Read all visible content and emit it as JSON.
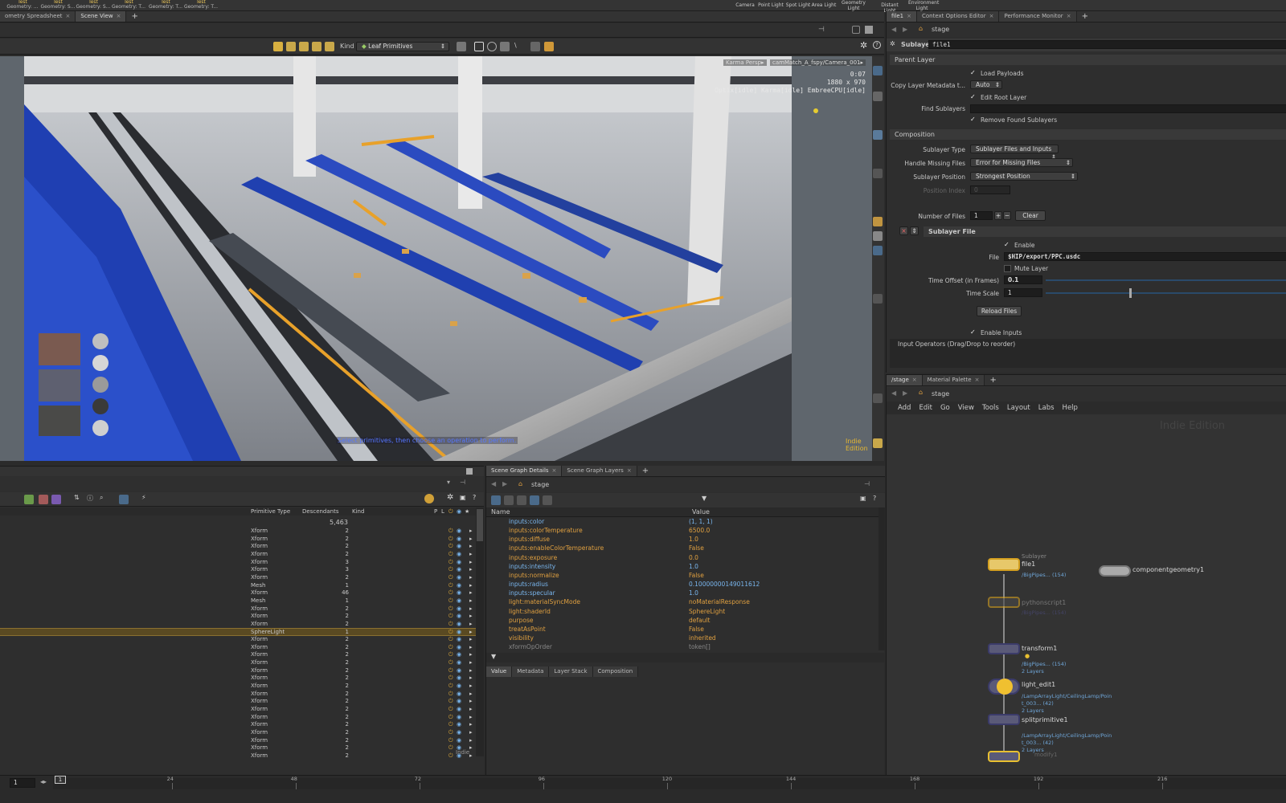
{
  "shelf": {
    "tools": [
      {
        "l1": "Test",
        "l2": "Geometry: ..."
      },
      {
        "l1": "Test",
        "l2": "Geometry: S..."
      },
      {
        "l1": "Test",
        "l2": "Geometry: S..."
      },
      {
        "l1": "Test",
        "l2": "Geometry: T..."
      },
      {
        "l1": "Test",
        "l2": "Geometry: T..."
      },
      {
        "l1": "Test",
        "l2": "Geometry: T..."
      }
    ],
    "lights": [
      "Camera",
      "Point Light",
      "Spot Light",
      "Area Light",
      "Geometry Light",
      "Distant Light",
      "Environment Light"
    ]
  },
  "left_tabs": [
    "ometry Spreadsheet",
    "Scene View"
  ],
  "viewport": {
    "kind_label": "Kind",
    "kind_value": "Leaf Primitives",
    "renderer": "Karma",
    "persp": "Persp",
    "camera": "camMatch_A_fspy/Camera_001",
    "time": "0:07",
    "resolution": "1880 x 970",
    "status": "Optix[idle] Karma[idle] EmbreeCPU[idle]",
    "prompt": "Select primitives, then choose an operation to perform.",
    "watermark": "Indie Edition"
  },
  "right_top_tabs": [
    "file1",
    "Context Options Editor",
    "Performance Monitor"
  ],
  "params": {
    "path": "stage",
    "node_type": "Sublayer",
    "node_name": "file1",
    "parent_layer": "Parent Layer",
    "load_payloads": "Load Payloads",
    "copy_meta_label": "Copy Layer Metadata t...",
    "copy_meta_value": "Auto",
    "edit_root": "Edit Root Layer",
    "find_sublayers": "Find Sublayers",
    "remove_found": "Remove Found Sublayers",
    "composition": "Composition",
    "sublayer_type_label": "Sublayer Type",
    "sublayer_type_value": "Sublayer Files and Inputs",
    "missing_label": "Handle Missing Files",
    "missing_value": "Error for Missing Files",
    "position_label": "Sublayer Position",
    "position_value": "Strongest Position",
    "position_index_label": "Position Index",
    "position_index_value": "0",
    "num_files_label": "Number of Files",
    "num_files_value": "1",
    "clear": "Clear",
    "sublayer_file": "Sublayer File",
    "enable": "Enable",
    "file_label": "File",
    "file_value": "$HIP/export/PPC.usdc",
    "mute": "Mute Layer",
    "time_offset_label": "Time Offset (in Frames)",
    "time_offset_value": "0.1",
    "time_scale_label": "Time Scale",
    "time_scale_value": "1",
    "reload": "Reload Files",
    "enable_inputs": "Enable Inputs",
    "input_ops": "Input Operators (Drag/Drop to reorder)"
  },
  "network": {
    "tabs": [
      "/stage",
      "Material Palette"
    ],
    "path": "stage",
    "menu": [
      "Add",
      "Edit",
      "Go",
      "View",
      "Tools",
      "Layout",
      "Labs",
      "Help"
    ],
    "watermark": "Indie Edition",
    "nodes": [
      {
        "type": "Sublayer",
        "name": "file1",
        "info": "/BigPipes... (154)"
      },
      {
        "name": "componentgeometry1"
      },
      {
        "name": "pythonscript1",
        "info": "/BigPipes... (154)"
      },
      {
        "name": "transform1",
        "info": "/BigPipes... (154)",
        "layers": "2 Layers"
      },
      {
        "name": "light_edit1",
        "info": "/LampArrayLight/CeilingLamp/Poin",
        "info2": "t_003... (42)",
        "layers": "2 Layers"
      },
      {
        "name": "splitprimitive1",
        "info": "/LampArrayLight/CeilingLamp/Poin",
        "info2": "t_003... (42)",
        "layers": "2 Layers"
      },
      {
        "name": "modify1"
      }
    ]
  },
  "tree": {
    "headers": [
      "Primitive Type",
      "Descendants",
      "Kind",
      "P",
      "L"
    ],
    "total": "5,463",
    "rows": [
      [
        "Xform",
        "2"
      ],
      [
        "Xform",
        "2"
      ],
      [
        "Xform",
        "2"
      ],
      [
        "Xform",
        "2"
      ],
      [
        "Xform",
        "3"
      ],
      [
        "Xform",
        "3"
      ],
      [
        "Xform",
        "2"
      ],
      [
        "Mesh",
        "1"
      ],
      [
        "Xform",
        "46"
      ],
      [
        "Mesh",
        "1"
      ],
      [
        "Xform",
        "2"
      ],
      [
        "Xform",
        "2"
      ],
      [
        "Xform",
        "2"
      ],
      [
        "SphereLight",
        "1"
      ],
      [
        "Xform",
        "2"
      ],
      [
        "Xform",
        "2"
      ],
      [
        "Xform",
        "2"
      ],
      [
        "Xform",
        "2"
      ],
      [
        "Xform",
        "2"
      ],
      [
        "Xform",
        "2"
      ],
      [
        "Xform",
        "2"
      ],
      [
        "Xform",
        "2"
      ],
      [
        "Xform",
        "2"
      ],
      [
        "Xform",
        "2"
      ],
      [
        "Xform",
        "2"
      ],
      [
        "Xform",
        "2"
      ],
      [
        "Xform",
        "2"
      ],
      [
        "Xform",
        "2"
      ],
      [
        "Xform",
        "2"
      ],
      [
        "Xform",
        "2"
      ]
    ],
    "watermark": "Indie"
  },
  "details": {
    "tabs": [
      "Scene Graph Details",
      "Scene Graph Layers"
    ],
    "path": "stage",
    "col_name": "Name",
    "col_value": "Value",
    "rows": [
      [
        "inputs:color",
        "(1, 1, 1)",
        "blue"
      ],
      [
        "inputs:colorTemperature",
        "6500.0",
        "orange"
      ],
      [
        "inputs:diffuse",
        "1.0",
        "orange"
      ],
      [
        "inputs:enableColorTemperature",
        "False",
        "orange"
      ],
      [
        "inputs:exposure",
        "0.0",
        "orange"
      ],
      [
        "inputs:intensity",
        "1.0",
        "blue"
      ],
      [
        "inputs:normalize",
        "False",
        "orange"
      ],
      [
        "inputs:radius",
        "0.10000000149011612",
        "blue"
      ],
      [
        "inputs:specular",
        "1.0",
        "blue"
      ],
      [
        "light:materialSyncMode",
        "noMaterialResponse",
        "orange"
      ],
      [
        "light:shaderId",
        "SphereLight",
        "orange"
      ],
      [
        "purpose",
        "default",
        "orange"
      ],
      [
        "treatAsPoint",
        "False",
        "orange"
      ],
      [
        "visibility",
        "inherited",
        "orange"
      ],
      [
        "xformOpOrder",
        "token[]",
        "grey"
      ]
    ],
    "bottom_tabs": [
      "Value",
      "Metadata",
      "Layer Stack",
      "Composition"
    ]
  },
  "timeline": {
    "frame": "1",
    "marker": "1",
    "ticks": [
      "24",
      "48",
      "72",
      "96",
      "120",
      "144",
      "168",
      "192",
      "216"
    ]
  },
  "colors": {
    "orange": "#e0a040",
    "blue": "#79b6ee",
    "grey": "#888888",
    "accent": "#e8b830",
    "selected_row": "#5a4a22"
  }
}
